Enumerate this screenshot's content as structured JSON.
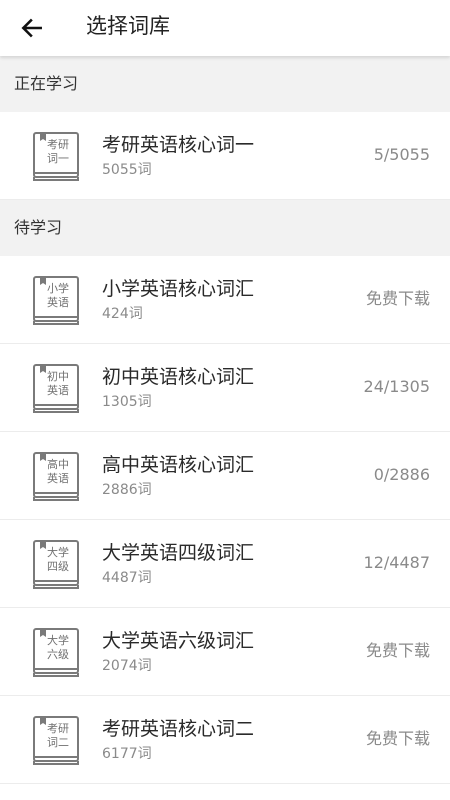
{
  "header": {
    "back_icon": "arrow-left-icon",
    "title": "选择词库"
  },
  "sections": {
    "learning": {
      "label": "正在学习"
    },
    "pending": {
      "label": "待学习"
    }
  },
  "books": [
    {
      "cover": "考研\n词一",
      "title": "考研英语核心词一",
      "count": "5055词",
      "status": "5/5055"
    },
    {
      "cover": "小学\n英语",
      "title": "小学英语核心词汇",
      "count": "424词",
      "status": "免费下载"
    },
    {
      "cover": "初中\n英语",
      "title": "初中英语核心词汇",
      "count": "1305词",
      "status": "24/1305"
    },
    {
      "cover": "高中\n英语",
      "title": "高中英语核心词汇",
      "count": "2886词",
      "status": "0/2886"
    },
    {
      "cover": "大学\n四级",
      "title": "大学英语四级词汇",
      "count": "4487词",
      "status": "12/4487"
    },
    {
      "cover": "大学\n六级",
      "title": "大学英语六级词汇",
      "count": "2074词",
      "status": "免费下载"
    },
    {
      "cover": "考研\n词二",
      "title": "考研英语核心词二",
      "count": "6177词",
      "status": "免费下载"
    }
  ]
}
